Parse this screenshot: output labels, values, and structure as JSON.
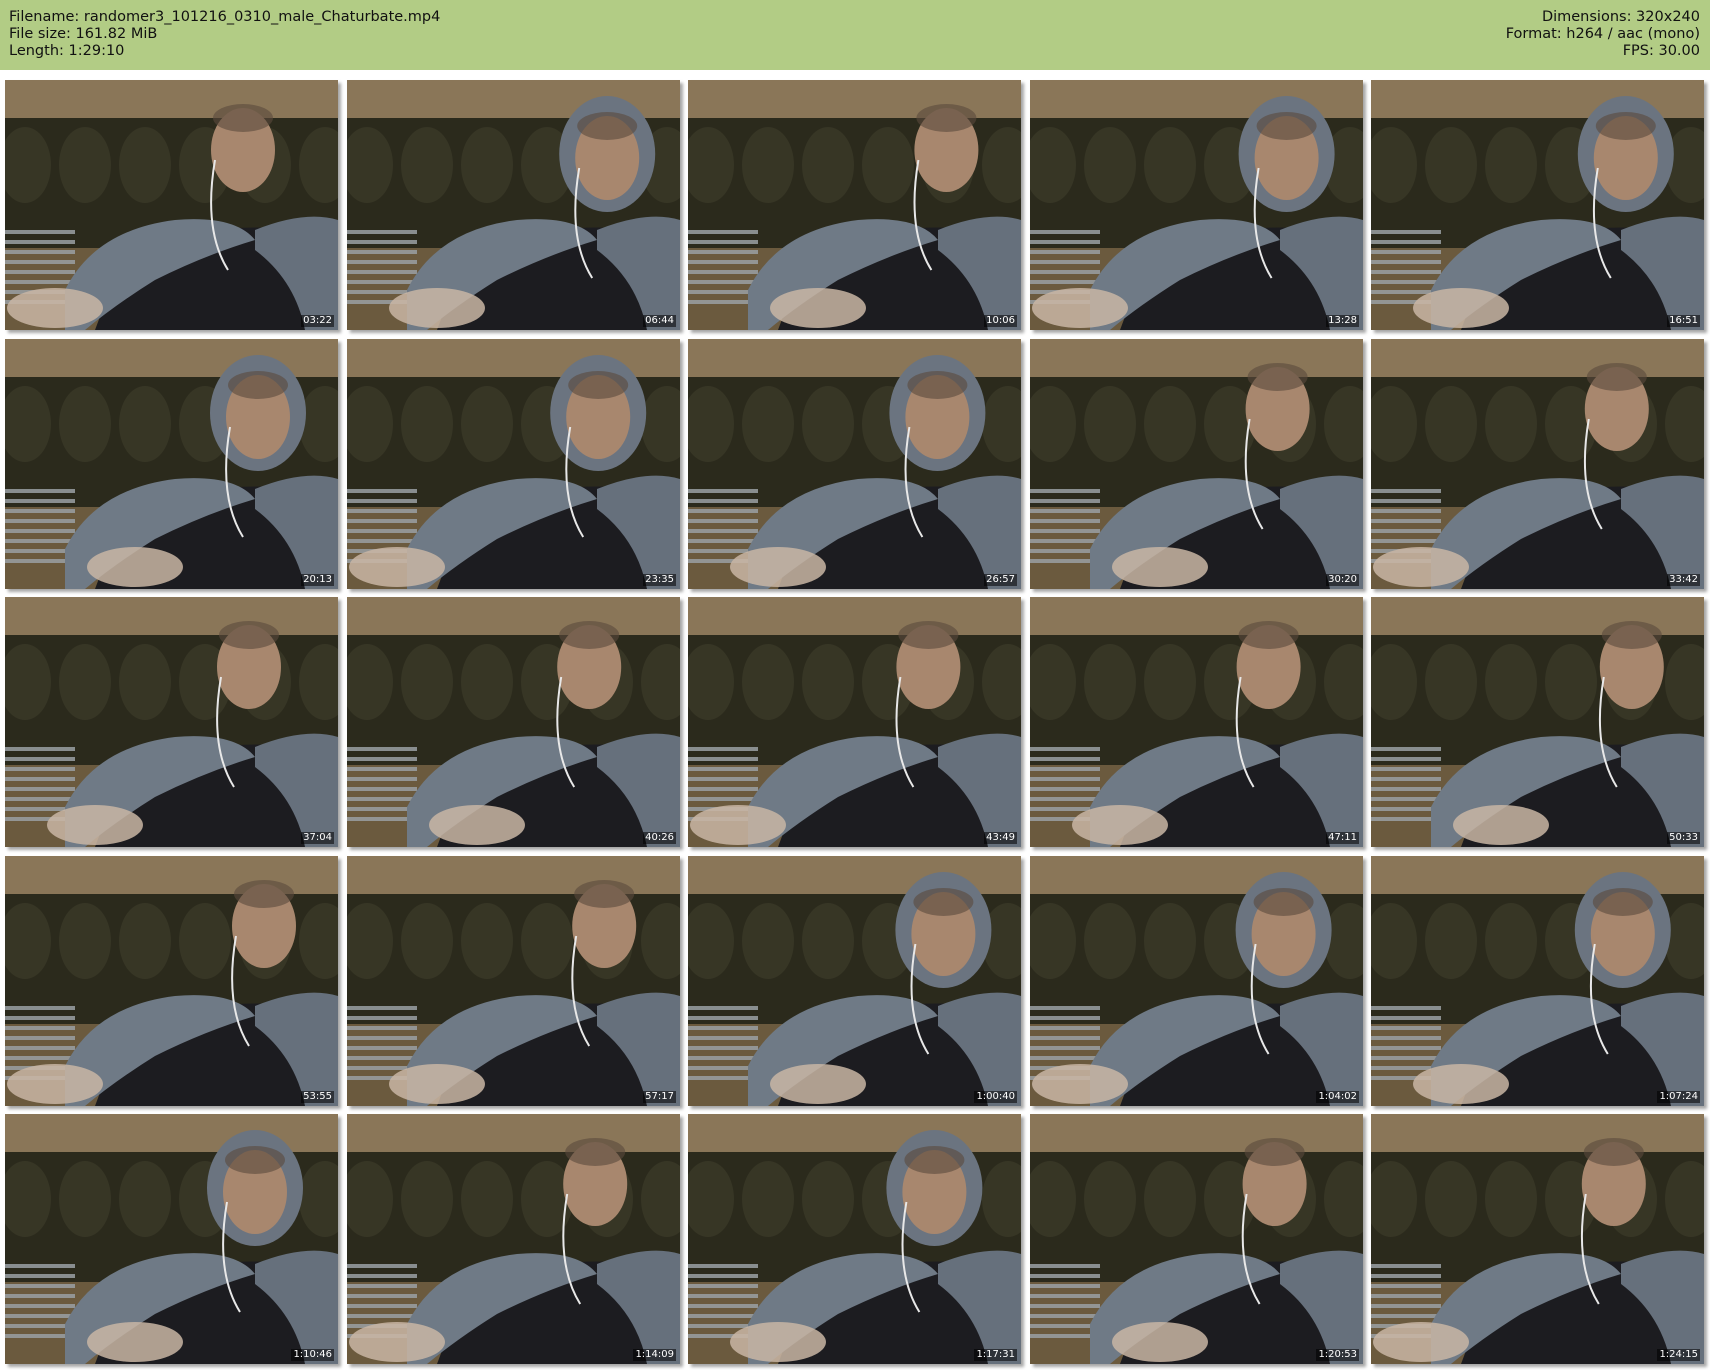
{
  "header": {
    "filename": "Filename: randomer3_101216_0310_male_Chaturbate.mp4",
    "filesize": "File size: 161.82 MiB",
    "length": "Length: 1:29:10",
    "dimensions": "Dimensions: 320x240",
    "format": "Format: h264 / aac (mono)",
    "fps": "FPS: 30.00"
  },
  "colors": {
    "header_bg": "#b2cc85",
    "timestamp_bg": "#000000"
  },
  "thumbnails": [
    {
      "time": "03:22",
      "hood": false
    },
    {
      "time": "06:44",
      "hood": true
    },
    {
      "time": "10:06",
      "hood": false
    },
    {
      "time": "13:28",
      "hood": true
    },
    {
      "time": "16:51",
      "hood": true
    },
    {
      "time": "20:13",
      "hood": true
    },
    {
      "time": "23:35",
      "hood": true
    },
    {
      "time": "26:57",
      "hood": true
    },
    {
      "time": "30:20",
      "hood": false
    },
    {
      "time": "33:42",
      "hood": false
    },
    {
      "time": "37:04",
      "hood": false
    },
    {
      "time": "40:26",
      "hood": false
    },
    {
      "time": "43:49",
      "hood": false
    },
    {
      "time": "47:11",
      "hood": false
    },
    {
      "time": "50:33",
      "hood": false
    },
    {
      "time": "53:55",
      "hood": false
    },
    {
      "time": "57:17",
      "hood": false
    },
    {
      "time": "1:00:40",
      "hood": true
    },
    {
      "time": "1:04:02",
      "hood": true
    },
    {
      "time": "1:07:24",
      "hood": true
    },
    {
      "time": "1:10:46",
      "hood": true
    },
    {
      "time": "1:14:09",
      "hood": false
    },
    {
      "time": "1:17:31",
      "hood": true
    },
    {
      "time": "1:20:53",
      "hood": false
    },
    {
      "time": "1:24:15",
      "hood": false
    }
  ]
}
